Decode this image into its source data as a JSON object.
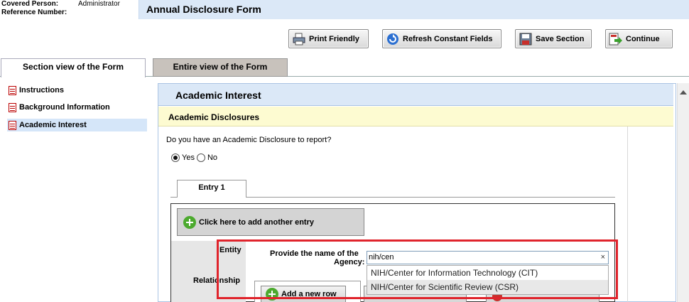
{
  "header": {
    "covered_person_label": "Covered Person:",
    "covered_person_value": "Administrator",
    "reference_number_label": "Reference Number:",
    "form_title": "Annual Disclosure Form"
  },
  "toolbar": {
    "print_label": "Print Friendly",
    "refresh_label": "Refresh Constant Fields",
    "save_label": "Save Section",
    "continue_label": "Continue"
  },
  "tabs": {
    "section_view": "Section view of the Form",
    "entire_view": "Entire view of the Form"
  },
  "sidebar": {
    "items": [
      {
        "label": "Instructions",
        "icon": "document-icon"
      },
      {
        "label": "Background Information",
        "icon": "document-icon"
      },
      {
        "label": "Academic Interest",
        "icon": "document-icon",
        "selected": true
      }
    ]
  },
  "main": {
    "section_title": "Academic Interest",
    "subsection_title": "Academic Disclosures",
    "question": "Do you have an Academic Disclosure to report?",
    "radio_yes": "Yes",
    "radio_no": "No",
    "selected_answer": "Yes",
    "entry_tab": "Entry 1",
    "add_entry_label": "Click here to add another entry",
    "entity_label": "Entity",
    "relationship_label": "Relationship",
    "agency_prompt_line1": "Provide the name of the",
    "agency_prompt_line2": "Agency:",
    "add_row_label": "Add a new row",
    "agency_input_value": "nih/cen",
    "clear_symbol": "×",
    "suggestions": [
      "NIH/Center for Information Technology (CIT)",
      "NIH/Center for Scientific Review (CSR)"
    ]
  },
  "colors": {
    "title_bar": "#dbe8f7",
    "subsection_bg": "#fdfbd1",
    "highlight_border": "#e0242c",
    "selected_nav": "#d5e6f9"
  }
}
